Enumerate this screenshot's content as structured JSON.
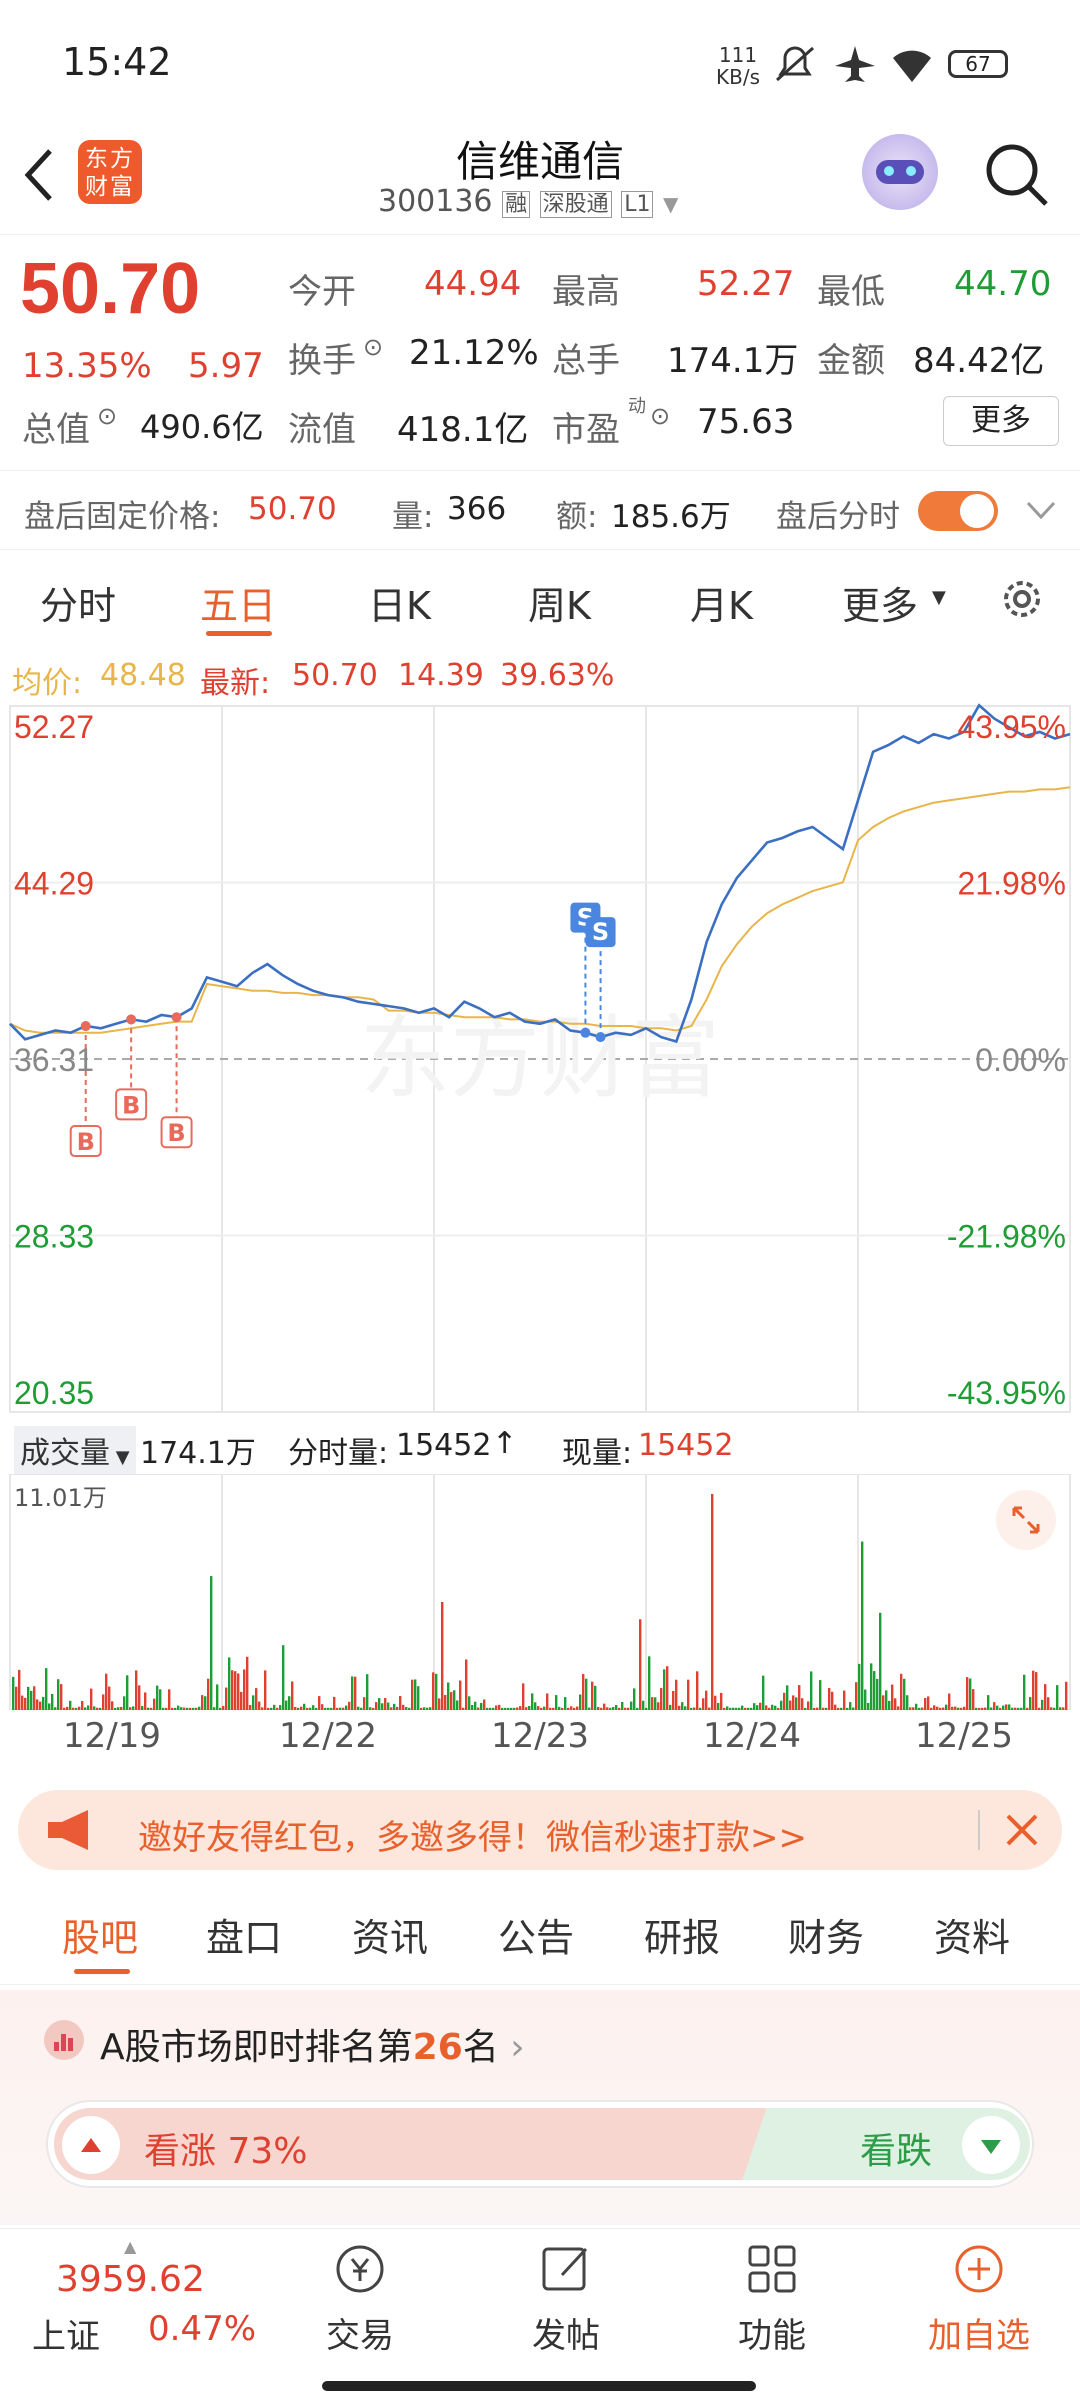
{
  "status": {
    "time": "15:42",
    "net_speed_value": "111",
    "net_speed_unit": "KB/s",
    "battery": "67"
  },
  "header": {
    "logo": "东方财富",
    "stock_name": "信维通信",
    "code": "300136",
    "tag_rong": "融",
    "tag_sgt": "深股通",
    "tag_level": "L1"
  },
  "quote": {
    "price": "50.70",
    "change_pct": "13.35%",
    "change": "5.97",
    "open_label": "今开",
    "open": "44.94",
    "high_label": "最高",
    "high": "52.27",
    "low_label": "最低",
    "low": "44.70",
    "turnover_label": "换手",
    "turnover": "21.12%",
    "volume_label": "总手",
    "volume": "174.1万",
    "amount_label": "金额",
    "amount": "84.42亿",
    "mktcap_label": "总值",
    "mktcap": "490.6亿",
    "float_label": "流值",
    "float_cap": "418.1亿",
    "pe_label": "市盈",
    "pe_sup": "动",
    "pe": "75.63",
    "more_button": "更多"
  },
  "after_hours": {
    "label": "盘后固定价格:",
    "price": "50.70",
    "vol_label": "量:",
    "vol": "366",
    "amt_label": "额:",
    "amt": "185.6万",
    "toggle_label": "盘后分时",
    "toggle_on": true
  },
  "period_tabs": [
    "分时",
    "五日",
    "日K",
    "周K",
    "月K",
    "更多"
  ],
  "active_period": "五日",
  "legend": {
    "avg_label": "均价:",
    "avg": "48.48",
    "latest_label": "最新:",
    "latest": "50.70",
    "chg": "14.39",
    "pct": "39.63%"
  },
  "chart_data": {
    "type": "line",
    "x_categories": [
      "12/19",
      "12/22",
      "12/23",
      "12/24",
      "12/25"
    ],
    "y_left_ticks": [
      "52.27",
      "44.29",
      "36.31",
      "28.33",
      "20.35"
    ],
    "y_right_ticks": [
      "43.95%",
      "21.98%",
      "0.00%",
      "-21.98%",
      "-43.95%"
    ],
    "ylim": [
      20.35,
      52.27
    ],
    "base_price": 36.31,
    "series": [
      {
        "name": "价格",
        "color": "#3b6fc2",
        "values": [
          37.9,
          37.2,
          37.4,
          37.6,
          37.5,
          37.8,
          37.7,
          37.9,
          38.1,
          38.0,
          38.3,
          38.2,
          38.6,
          40.0,
          39.8,
          39.6,
          40.2,
          40.6,
          40.1,
          39.7,
          39.4,
          39.2,
          39.1,
          38.9,
          38.8,
          38.7,
          38.6,
          38.4,
          38.6,
          38.2,
          38.9,
          38.6,
          38.2,
          38.4,
          38.0,
          37.9,
          38.1,
          37.6,
          37.5,
          37.3,
          37.5,
          37.4,
          37.7,
          37.3,
          37.1,
          39.0,
          41.6,
          43.3,
          44.5,
          45.3,
          46.1,
          46.3,
          46.6,
          46.8,
          46.3,
          45.8,
          48.0,
          50.2,
          50.5,
          50.9,
          50.6,
          51.0,
          50.8,
          51.1,
          52.3,
          51.7,
          51.3,
          50.9,
          51.1,
          50.8,
          51.0
        ]
      },
      {
        "name": "均价",
        "color": "#e8b54a",
        "values": [
          37.9,
          37.6,
          37.5,
          37.5,
          37.5,
          37.5,
          37.5,
          37.6,
          37.7,
          37.8,
          37.9,
          38.0,
          38.0,
          39.7,
          39.6,
          39.5,
          39.4,
          39.4,
          39.3,
          39.3,
          39.2,
          39.2,
          39.1,
          39.1,
          39.0,
          38.5,
          38.5,
          38.4,
          38.4,
          38.3,
          38.2,
          38.2,
          38.2,
          38.1,
          38.1,
          38.0,
          38.0,
          37.9,
          37.9,
          37.8,
          37.8,
          37.8,
          37.7,
          37.7,
          37.6,
          37.8,
          39.0,
          40.5,
          41.5,
          42.3,
          42.9,
          43.3,
          43.6,
          43.9,
          44.1,
          44.3,
          46.2,
          46.8,
          47.2,
          47.5,
          47.7,
          47.9,
          48.0,
          48.1,
          48.2,
          48.3,
          48.4,
          48.4,
          48.5,
          48.5,
          48.6
        ]
      }
    ],
    "markers": [
      {
        "type": "B",
        "x_index": 5,
        "color": "#e86a5a"
      },
      {
        "type": "B",
        "x_index": 8,
        "color": "#e86a5a"
      },
      {
        "type": "B",
        "x_index": 11,
        "color": "#e86a5a"
      },
      {
        "type": "S",
        "x_index": 38,
        "color": "#4a86e0"
      },
      {
        "type": "S",
        "x_index": 39,
        "color": "#4a86e0"
      }
    ],
    "volume": {
      "label": "成交量",
      "total": "174.1万",
      "fenshi_label": "分时量:",
      "fenshi": "15452",
      "xian_label": "现量:",
      "xian": "15452",
      "max_label": "11.01万"
    }
  },
  "promo": {
    "text": "邀好友得红包，多邀多得！微信秒速打款>>"
  },
  "sub_tabs": [
    "股吧",
    "盘口",
    "资讯",
    "公告",
    "研报",
    "财务",
    "资料"
  ],
  "active_sub_tab": "股吧",
  "rank": {
    "pre": "A股市场即时排名第",
    "num": "26",
    "post": "名",
    "up_label": "看涨",
    "up_pct": "73%",
    "down_label": "看跌",
    "up_ratio": 0.73
  },
  "bottom": {
    "index_value": "3959.62",
    "index_name": "上证",
    "index_pct": "0.47%",
    "trade": "交易",
    "post": "发帖",
    "func": "功能",
    "add": "加自选"
  },
  "colors": {
    "up": "#e0402f",
    "down": "#1f9d35",
    "accent": "#f07a3a"
  }
}
